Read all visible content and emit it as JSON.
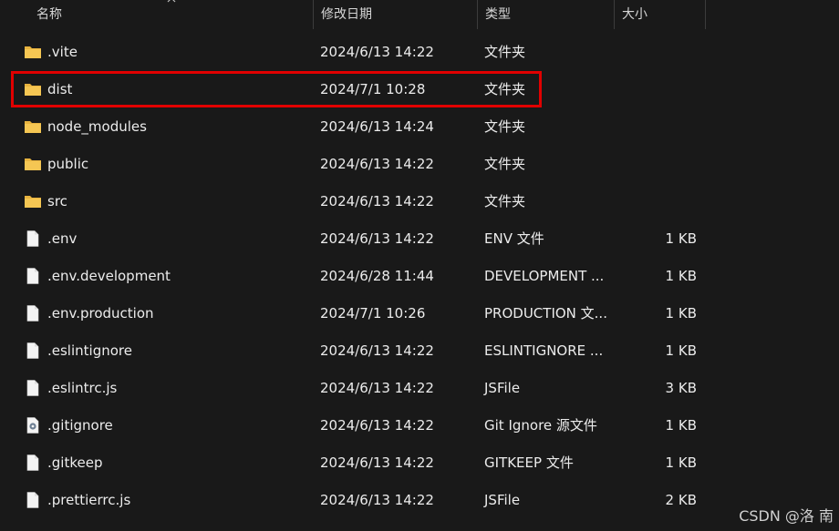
{
  "columns": {
    "name": "名称",
    "date": "修改日期",
    "type": "类型",
    "size": "大小"
  },
  "files": [
    {
      "name": ".vite",
      "date": "2024/6/13 14:22",
      "type": "文件夹",
      "size": "",
      "icon": "folder-icon"
    },
    {
      "name": "dist",
      "date": "2024/7/1 10:28",
      "type": "文件夹",
      "size": "",
      "icon": "folder-icon"
    },
    {
      "name": "node_modules",
      "date": "2024/6/13 14:24",
      "type": "文件夹",
      "size": "",
      "icon": "folder-icon"
    },
    {
      "name": "public",
      "date": "2024/6/13 14:22",
      "type": "文件夹",
      "size": "",
      "icon": "folder-icon"
    },
    {
      "name": "src",
      "date": "2024/6/13 14:22",
      "type": "文件夹",
      "size": "",
      "icon": "folder-icon"
    },
    {
      "name": ".env",
      "date": "2024/6/13 14:22",
      "type": "ENV 文件",
      "size": "1 KB",
      "icon": "file-icon"
    },
    {
      "name": ".env.development",
      "date": "2024/6/28 11:44",
      "type": "DEVELOPMENT ...",
      "size": "1 KB",
      "icon": "file-icon"
    },
    {
      "name": ".env.production",
      "date": "2024/7/1 10:26",
      "type": "PRODUCTION 文...",
      "size": "1 KB",
      "icon": "file-icon"
    },
    {
      "name": ".eslintignore",
      "date": "2024/6/13 14:22",
      "type": "ESLINTIGNORE ...",
      "size": "1 KB",
      "icon": "file-icon"
    },
    {
      "name": ".eslintrc.js",
      "date": "2024/6/13 14:22",
      "type": "JSFile",
      "size": "3 KB",
      "icon": "file-icon"
    },
    {
      "name": ".gitignore",
      "date": "2024/6/13 14:22",
      "type": "Git Ignore 源文件",
      "size": "1 KB",
      "icon": "gear-file-icon"
    },
    {
      "name": ".gitkeep",
      "date": "2024/6/13 14:22",
      "type": "GITKEEP 文件",
      "size": "1 KB",
      "icon": "file-icon"
    },
    {
      "name": ".prettierrc.js",
      "date": "2024/6/13 14:22",
      "type": "JSFile",
      "size": "2 KB",
      "icon": "file-icon"
    }
  ],
  "highlighted_row": 1,
  "watermark": "CSDN @洛 南",
  "colors": {
    "background": "#191919",
    "highlight_border": "#e10000",
    "folder": "#f2c24e"
  }
}
